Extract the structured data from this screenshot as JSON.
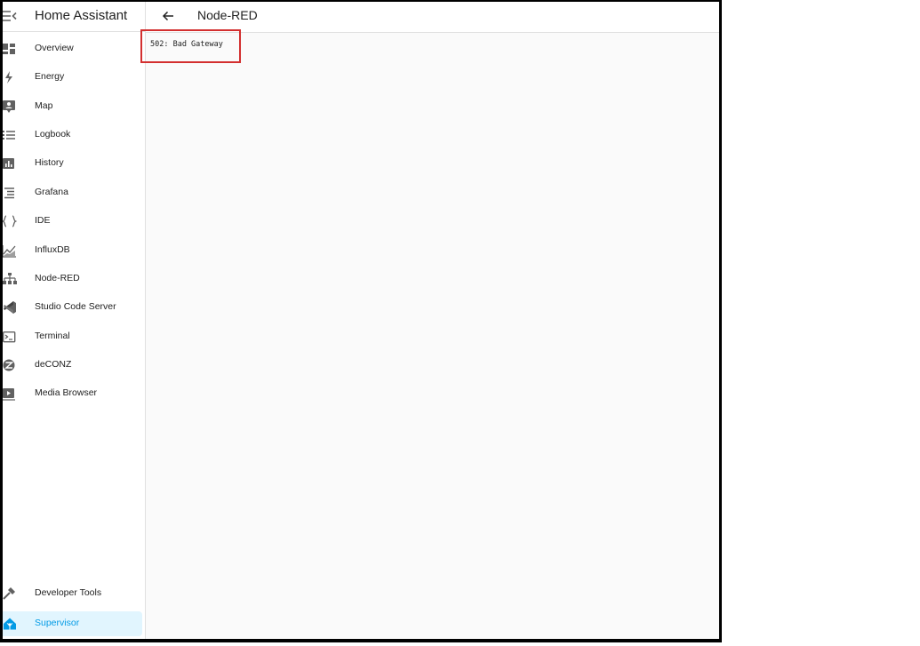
{
  "app": {
    "title": "Home Assistant"
  },
  "page": {
    "title": "Node-RED",
    "error_message": "502: Bad Gateway"
  },
  "colors": {
    "active_bg": "#e1f5fe",
    "active_text": "#039be5",
    "icon": "#616161",
    "highlight": "#d32f2f"
  },
  "sidebar": {
    "menu_icon": "menu-open-icon",
    "items": [
      {
        "label": "Overview",
        "icon": "dashboard-icon"
      },
      {
        "label": "Energy",
        "icon": "lightning-icon"
      },
      {
        "label": "Map",
        "icon": "map-account-icon"
      },
      {
        "label": "Logbook",
        "icon": "list-icon"
      },
      {
        "label": "History",
        "icon": "chart-box-icon"
      },
      {
        "label": "Grafana",
        "icon": "text-align-icon"
      },
      {
        "label": "IDE",
        "icon": "code-braces-icon"
      },
      {
        "label": "InfluxDB",
        "icon": "chart-areaspline-icon"
      },
      {
        "label": "Node-RED",
        "icon": "sitemap-icon"
      },
      {
        "label": "Studio Code Server",
        "icon": "vscode-icon"
      },
      {
        "label": "Terminal",
        "icon": "console-icon"
      },
      {
        "label": "deCONZ",
        "icon": "zigbee-icon"
      },
      {
        "label": "Media Browser",
        "icon": "play-box-icon"
      }
    ],
    "bottom_items": [
      {
        "label": "Developer Tools",
        "icon": "hammer-icon"
      },
      {
        "label": "Supervisor",
        "icon": "home-assistant-icon",
        "active": true
      }
    ]
  }
}
